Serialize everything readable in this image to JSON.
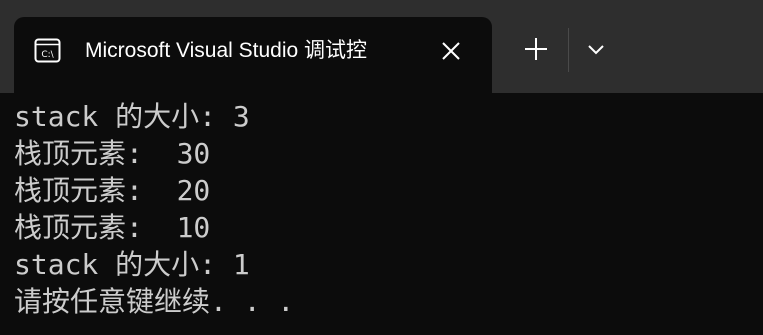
{
  "window": {
    "tab_title": "Microsoft Visual Studio 调试控"
  },
  "icons": {
    "tab_icon": "console-app-icon",
    "close": "close-icon",
    "new_tab": "plus-icon",
    "dropdown": "chevron-down-icon"
  },
  "colors": {
    "titlebar_bg": "#2e2e2e",
    "terminal_bg": "#0c0c0c",
    "terminal_text": "#cccccc",
    "title_text": "#ffffff"
  },
  "console": {
    "lines": [
      "stack 的大小: 3",
      "栈顶元素:  30",
      "栈顶元素:  20",
      "栈顶元素:  10",
      "stack 的大小: 1",
      "请按任意键继续. . ."
    ]
  }
}
